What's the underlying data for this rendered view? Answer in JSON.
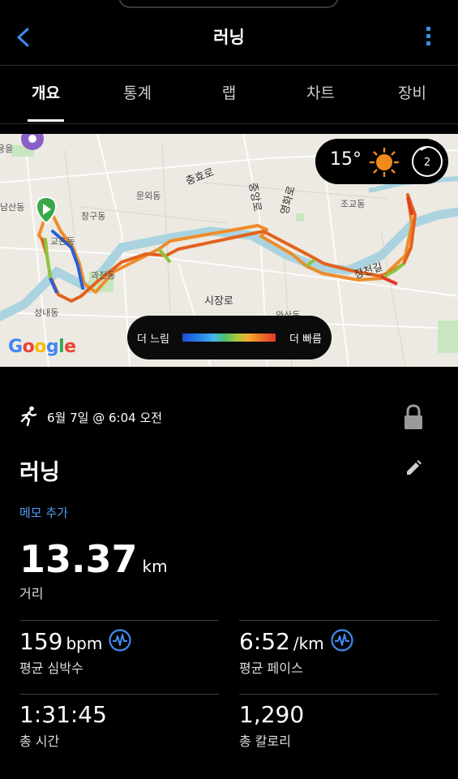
{
  "header": {
    "title": "러닝"
  },
  "tabs": [
    {
      "label": "개요"
    },
    {
      "label": "통계"
    },
    {
      "label": "랩"
    },
    {
      "label": "차트"
    },
    {
      "label": "장비"
    }
  ],
  "map": {
    "weather": {
      "temperature": "15°",
      "wind": "2"
    },
    "legend": {
      "slow": "더 느림",
      "fast": "더 빠름"
    },
    "attribution": "Google",
    "labels": [
      "충효로",
      "문외동",
      "창구동",
      "교촌동",
      "과전동",
      "시장로",
      "성내동",
      "장천길",
      "조교동",
      "중앙로",
      "영화로",
      "용을",
      "남산동",
      "와산동"
    ],
    "route_colors": {
      "fast": "#e33a2a",
      "mid": "#ef8c2a",
      "slow": "#2a5fd6",
      "ok": "#8cc63f"
    }
  },
  "activity": {
    "date": "6월 7일 @ 6:04 오전",
    "name": "러닝",
    "memo": "메모 추가",
    "distance": {
      "value": "13.37",
      "unit": "km",
      "label": "거리"
    },
    "heart_rate": {
      "value": "159",
      "unit": "bpm",
      "label": "평균 심박수"
    },
    "pace": {
      "value": "6:52",
      "unit": "/km",
      "label": "평균 페이스"
    },
    "time": {
      "value": "1:31:45",
      "label": "총 시간"
    },
    "calories": {
      "value": "1,290",
      "label": "총 칼로리"
    }
  },
  "colors": {
    "accent": "#3d8cf0",
    "link": "#4d9ef0",
    "background": "#000000"
  }
}
